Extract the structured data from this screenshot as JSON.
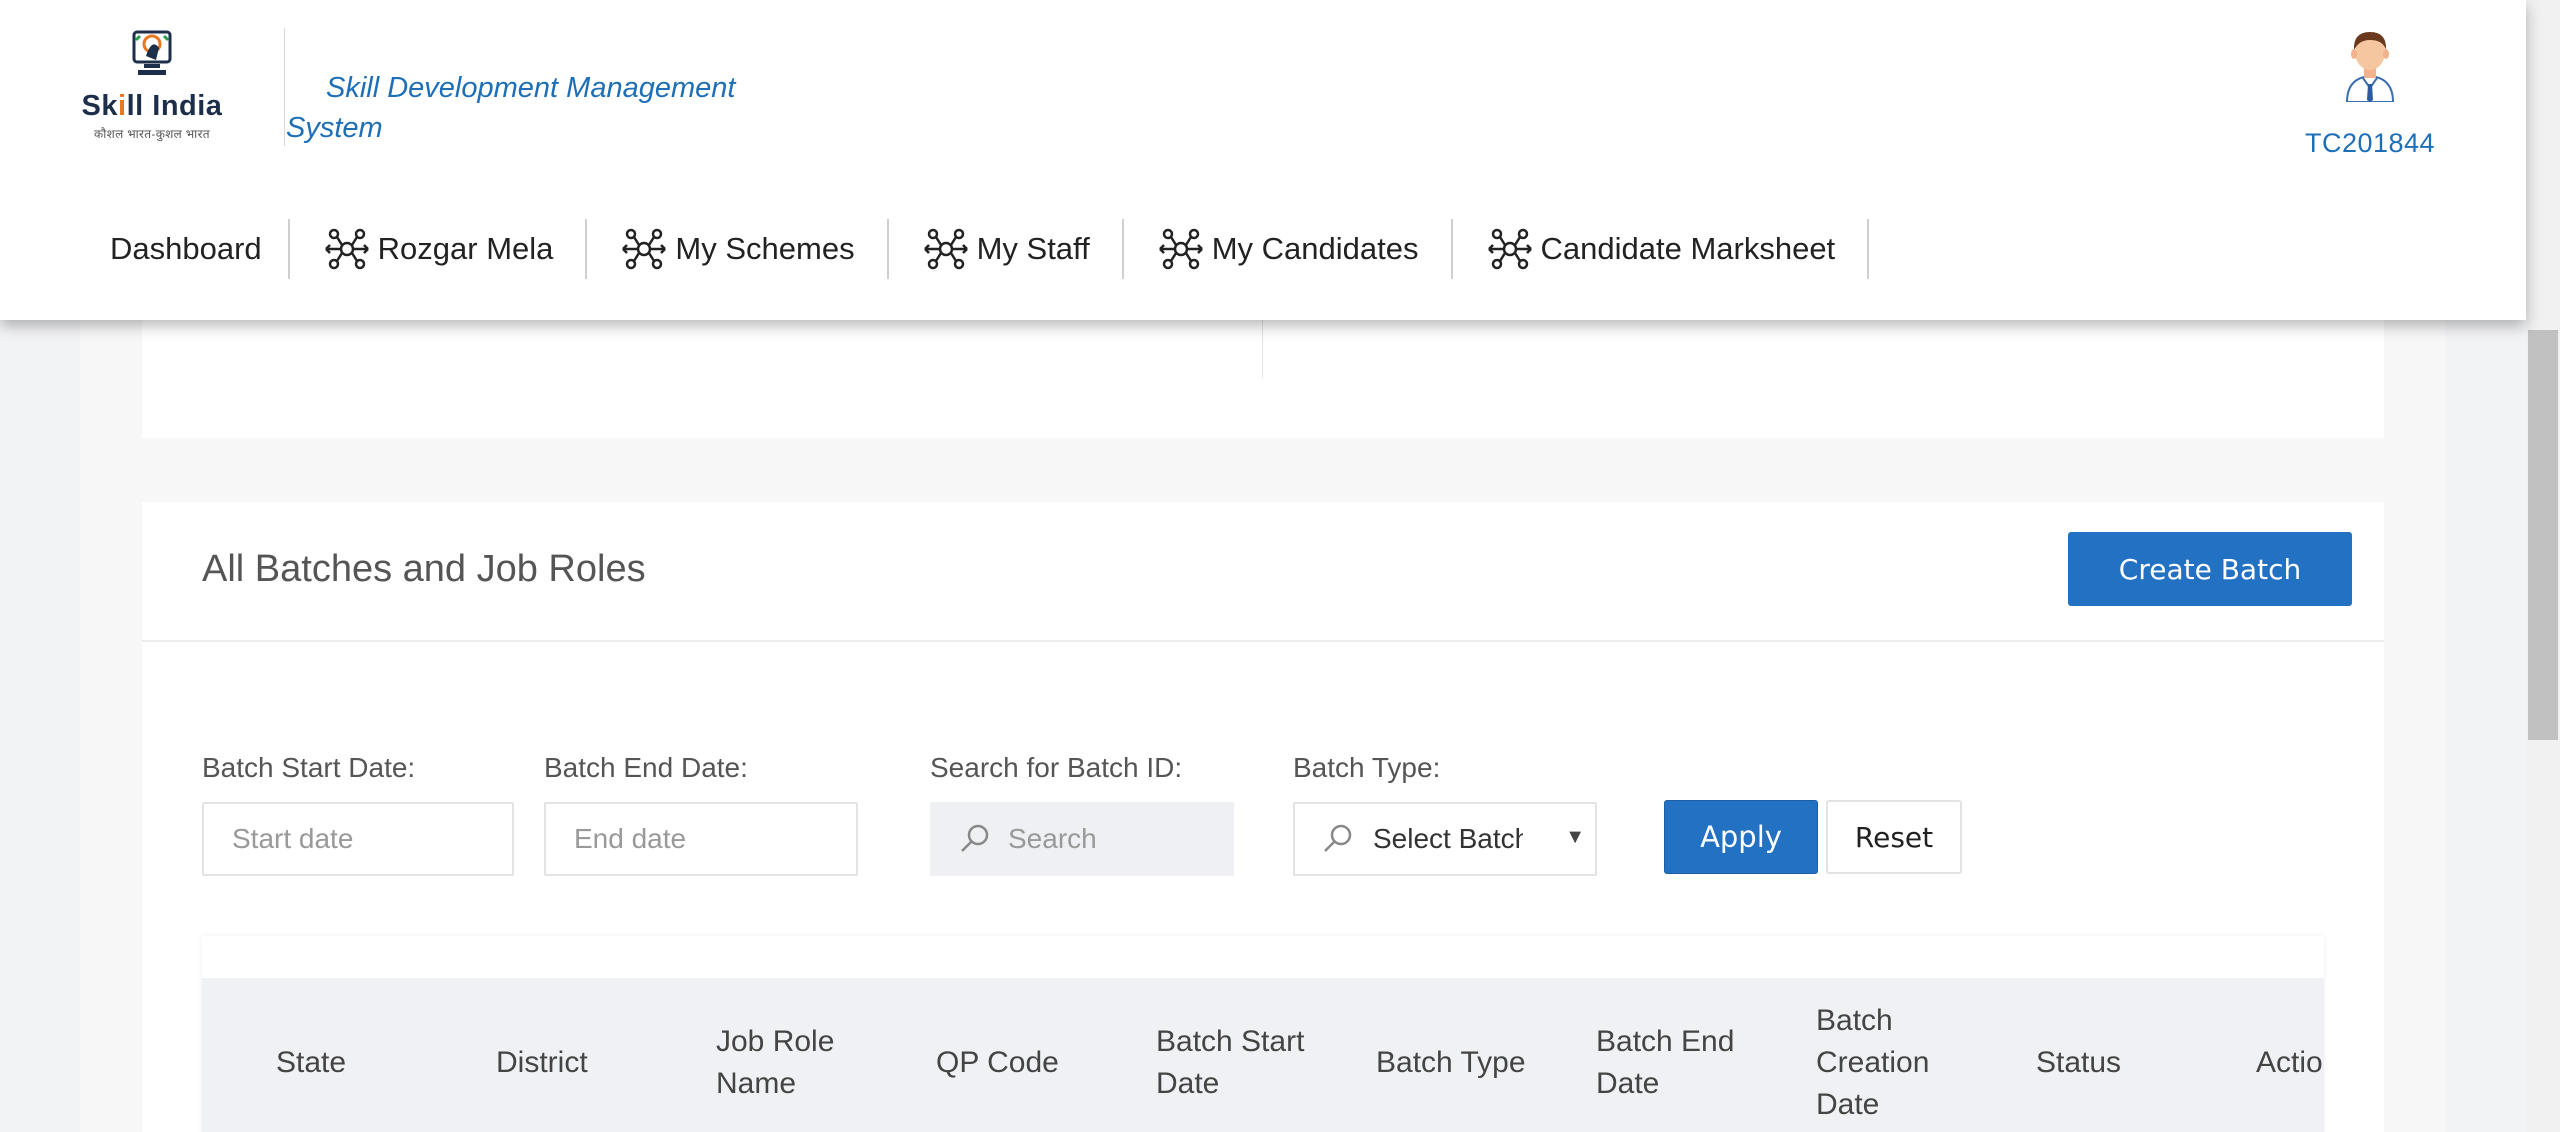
{
  "header": {
    "logo": {
      "title_part1": "Sk",
      "title_accent": "i",
      "title_part2": "ll India",
      "subtitle": "कौशल भारत-कुशल भारत"
    },
    "system_title": "Skill Development Management System",
    "user_id": "TC201844"
  },
  "nav": [
    {
      "label": "Dashboard",
      "icon": null
    },
    {
      "label": "Rozgar Mela",
      "icon": "network-icon"
    },
    {
      "label": "My Schemes",
      "icon": "network-icon"
    },
    {
      "label": "My Staff",
      "icon": "network-icon"
    },
    {
      "label": "My Candidates",
      "icon": "network-icon"
    },
    {
      "label": "Candidate Marksheet",
      "icon": "network-icon"
    }
  ],
  "batches": {
    "title": "All Batches and Job Roles",
    "create_label": "Create Batch",
    "filters": {
      "start_label": "Batch Start Date:",
      "start_placeholder": "Start date",
      "end_label": "Batch End Date:",
      "end_placeholder": "End date",
      "search_label": "Search for Batch ID:",
      "search_placeholder": "Search",
      "type_label": "Batch Type:",
      "type_selected": "Select Batch Type"
    },
    "apply_label": "Apply",
    "reset_label": "Reset",
    "columns": [
      "State",
      "District",
      "Job Role Name",
      "QP Code",
      "Batch Start Date",
      "Batch Type",
      "Batch End Date",
      "Batch Creation Date",
      "Status",
      "Actio"
    ]
  },
  "colors": {
    "primary": "#2271c3",
    "link": "#1f6fb6",
    "table_header_bg": "#f0f1f4"
  }
}
